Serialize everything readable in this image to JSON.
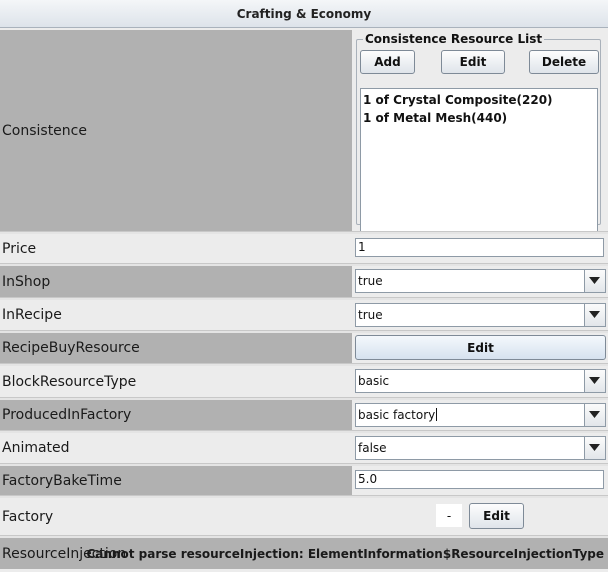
{
  "header": {
    "title": "Crafting & Economy"
  },
  "consistence": {
    "label": "Consistence",
    "group_title": "Consistence Resource List",
    "add_label": "Add",
    "edit_label": "Edit",
    "delete_label": "Delete",
    "items": [
      "1 of Crystal Composite(220)",
      "1 of Metal Mesh(440)"
    ]
  },
  "price": {
    "label": "Price",
    "value": "1"
  },
  "in_shop": {
    "label": "InShop",
    "value": "true"
  },
  "in_recipe": {
    "label": "InRecipe",
    "value": "true"
  },
  "recipe_buy_resource": {
    "label": "RecipeBuyResource",
    "button": "Edit"
  },
  "block_resource_type": {
    "label": "BlockResourceType",
    "value": "basic"
  },
  "produced_in_factory": {
    "label": "ProducedInFactory",
    "value": "basic factory"
  },
  "animated": {
    "label": "Animated",
    "value": "false"
  },
  "factory_bake_time": {
    "label": "FactoryBakeTime",
    "value": "5.0"
  },
  "factory": {
    "label": "Factory",
    "value": "-",
    "button": "Edit"
  },
  "resource_injection": {
    "label": "ResourceInjection",
    "message": "Cannot parse resourceInjection: ElementInformation$ResourceInjectionType"
  }
}
